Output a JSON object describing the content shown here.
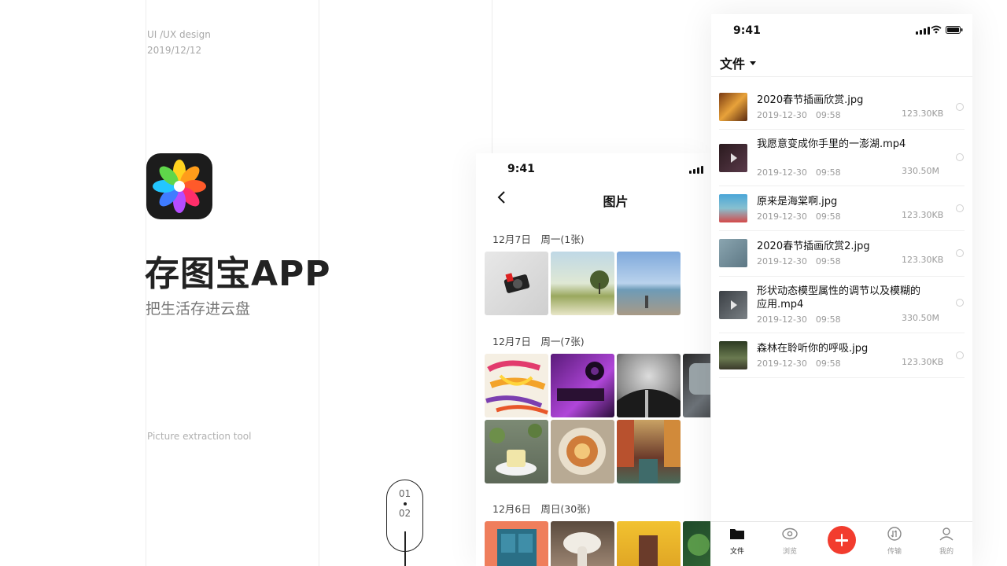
{
  "cover": {
    "design_label": "UI /UX design",
    "date": "2019/12/12",
    "app_name": "存图宝APP",
    "slogan": "把生活存进云盘",
    "tagline": "Picture extraction tool",
    "pager": {
      "current": "01",
      "next": "02"
    }
  },
  "gallery_screen": {
    "status_time": "9:41",
    "title": "图片",
    "groups": [
      {
        "label": "12月7日　周一(1张)",
        "thumbs": [
          "camera-photo",
          "field-tree-photo",
          "beach-photo"
        ]
      },
      {
        "label": "12月7日　周一(7张)",
        "thumbs": [
          "paint-strokes-photo",
          "synth-purple-photo",
          "dome-architecture-photo",
          "car-window-photo",
          "dessert-table-photo",
          "plate-art-photo",
          "venice-canal-photo"
        ]
      },
      {
        "label": "12月6日　周日(30张)",
        "thumbs": [
          "blue-door-photo",
          "mushroom-photo",
          "yellow-street-photo",
          "green-leaves-photo"
        ]
      }
    ]
  },
  "files_screen": {
    "status_time": "9:41",
    "header": "文件",
    "files": [
      {
        "name": "2020春节插画欣赏.jpg",
        "date": "2019-12-30　09:58",
        "size": "123.30KB",
        "type": "image"
      },
      {
        "name": "我愿意变成你手里的一澎湖.mp4",
        "date": "2019-12-30　09:58",
        "size": "330.50M",
        "type": "video"
      },
      {
        "name": "原来是海棠啊.jpg",
        "date": "2019-12-30　09:58",
        "size": "123.30KB",
        "type": "image"
      },
      {
        "name": "2020春节插画欣赏2.jpg",
        "date": "2019-12-30　09:58",
        "size": "123.30KB",
        "type": "image"
      },
      {
        "name": "形状动态模型属性的调节以及模糊的应用.mp4",
        "date": "2019-12-30　09:58",
        "size": "330.50M",
        "type": "video"
      },
      {
        "name": "森林在聆听你的呼吸.jpg",
        "date": "2019-12-30　09:58",
        "size": "123.30KB",
        "type": "image"
      }
    ],
    "tabs": [
      {
        "label": "文件",
        "icon": "folder-icon",
        "active": true
      },
      {
        "label": "浏览",
        "icon": "eye-icon",
        "active": false
      },
      {
        "label": "",
        "icon": "plus-icon",
        "active": false
      },
      {
        "label": "传输",
        "icon": "transfer-icon",
        "active": false
      },
      {
        "label": "我的",
        "icon": "user-icon",
        "active": false
      }
    ],
    "accent_color": "#f23c2e"
  }
}
